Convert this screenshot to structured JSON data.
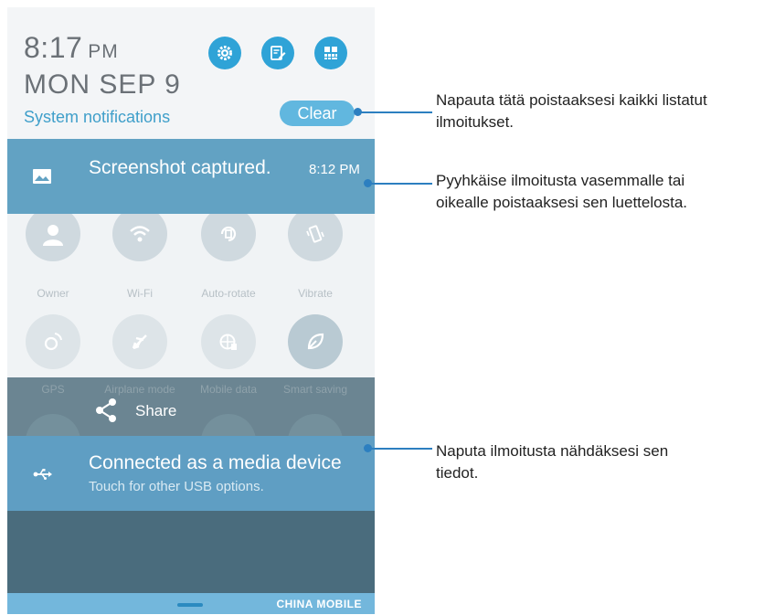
{
  "header": {
    "time": "8:17",
    "ampm": "PM",
    "date": "MON SEP 9",
    "system_notifications": "System notifications",
    "clear_label": "Clear",
    "quick_buttons": [
      "settings-icon",
      "edit-icon",
      "quick-settings-grid-icon"
    ]
  },
  "notifications": [
    {
      "title": "Screenshot captured.",
      "time": "8:12 PM",
      "icon": "image-icon"
    },
    {
      "title": "Connected as a media device",
      "subtitle": "Touch for other USB options.",
      "icon": "usb-icon"
    }
  ],
  "quick_settings": [
    {
      "label": "Owner",
      "icon": "avatar-icon"
    },
    {
      "label": "Wi-Fi",
      "icon": "wifi-icon"
    },
    {
      "label": "Auto-rotate",
      "icon": "auto-rotate-icon"
    },
    {
      "label": "Vibrate",
      "icon": "vibrate-icon"
    },
    {
      "label": "GPS",
      "icon": "gps-icon"
    },
    {
      "label": "Airplane mode",
      "icon": "airplane-icon"
    },
    {
      "label": "Mobile data",
      "icon": "mobile-data-icon"
    },
    {
      "label": "Smart saving",
      "icon": "leaf-icon"
    }
  ],
  "share": {
    "label": "Share"
  },
  "status_bar": {
    "carrier": "CHINA  MOBILE"
  },
  "callouts": [
    {
      "line1": "Napauta tätä poistaaksesi kaikki listatut",
      "line2": "ilmoitukset."
    },
    {
      "line1": "Pyyhkäise ilmoitusta vasemmalle tai",
      "line2": "oikealle poistaaksesi sen luettelosta."
    },
    {
      "line1": "Naputa ilmoitusta nähdäksesi sen",
      "line2": "tiedot."
    }
  ],
  "colors": {
    "accent": "#2fa3d7",
    "notification_bg": "#62a2c3",
    "callout_line": "#2c7fc0"
  }
}
